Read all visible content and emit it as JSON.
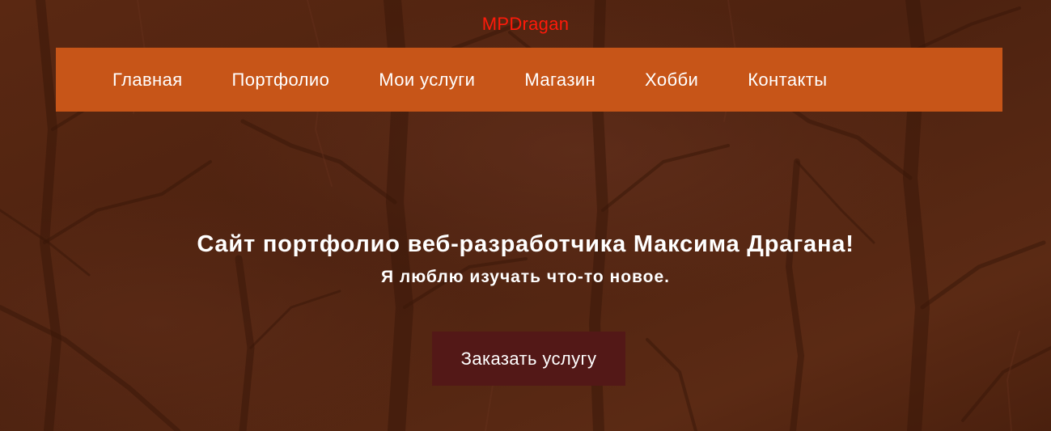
{
  "header": {
    "logo_text": "MPDragan"
  },
  "nav": {
    "items": [
      {
        "label": "Главная"
      },
      {
        "label": "Портфолио"
      },
      {
        "label": "Мои услуги"
      },
      {
        "label": "Магазин"
      },
      {
        "label": "Хобби"
      },
      {
        "label": "Контакты"
      }
    ]
  },
  "hero": {
    "title": "Сайт портфолио веб-разработчика Максима Драгана!",
    "subtitle": "Я люблю изучать что-то новое.",
    "cta_label": "Заказать услугу"
  },
  "colors": {
    "logo": "#ff1a0a",
    "nav_background": "#c75518",
    "button_background": "#531817",
    "overlay": "#4e2210"
  }
}
